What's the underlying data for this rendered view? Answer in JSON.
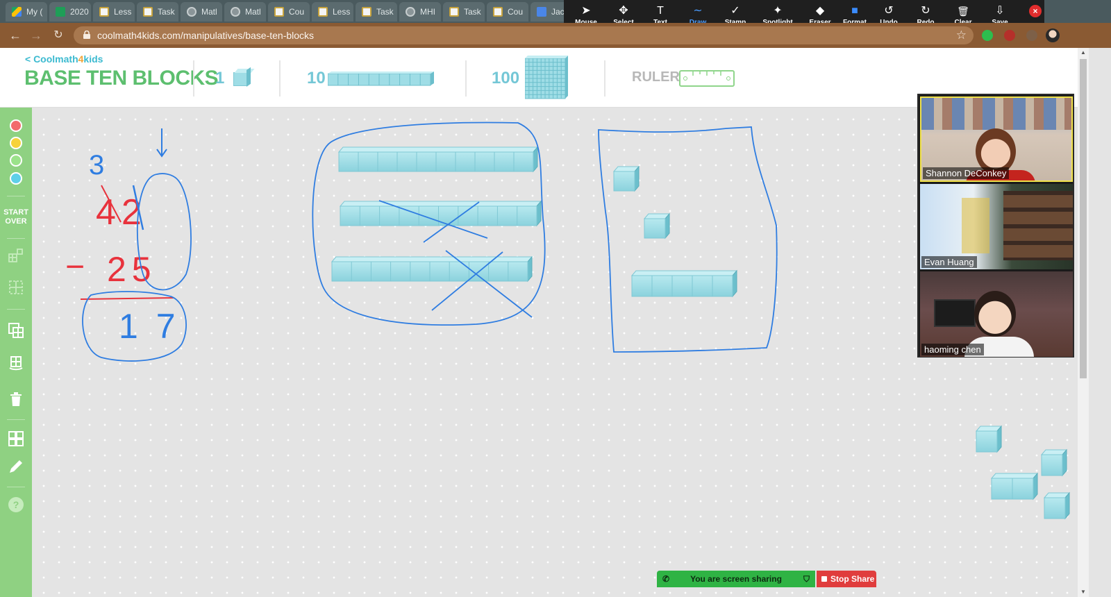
{
  "browser": {
    "tabs": [
      {
        "label": "My (",
        "icon": "drive"
      },
      {
        "label": "2020",
        "icon": "sheets"
      },
      {
        "label": "Less",
        "icon": "doc"
      },
      {
        "label": "Task",
        "icon": "doc"
      },
      {
        "label": "Matl",
        "icon": "globe"
      },
      {
        "label": "Matl",
        "icon": "globe"
      },
      {
        "label": "Cou",
        "icon": "doc"
      },
      {
        "label": "Less",
        "icon": "doc"
      },
      {
        "label": "Task",
        "icon": "doc"
      },
      {
        "label": "MHI",
        "icon": "globe"
      },
      {
        "label": "Task",
        "icon": "doc"
      },
      {
        "label": "Cou",
        "icon": "doc"
      },
      {
        "label": "Jacc",
        "icon": "gdoc"
      }
    ],
    "url": "coolmath4kids.com/manipulatives/base-ten-blocks"
  },
  "annotation_toolbar": {
    "tools": [
      {
        "label": "Mouse",
        "icon": "cursor-icon"
      },
      {
        "label": "Select",
        "icon": "move-icon"
      },
      {
        "label": "Text",
        "icon": "text-icon"
      },
      {
        "label": "Draw",
        "icon": "squiggle-icon",
        "active": true
      },
      {
        "label": "Stamp",
        "icon": "check-icon"
      },
      {
        "label": "Spotlight",
        "icon": "wand-icon"
      },
      {
        "label": "Eraser",
        "icon": "eraser-icon"
      },
      {
        "label": "Format",
        "icon": "format-icon"
      },
      {
        "label": "Undo",
        "icon": "undo-icon"
      },
      {
        "label": "Redo",
        "icon": "redo-icon"
      },
      {
        "label": "Clear",
        "icon": "trash-icon"
      },
      {
        "label": "Save",
        "icon": "save-icon"
      }
    ],
    "active_color": "#4a9cff"
  },
  "app": {
    "back_link_prefix": "< Coolmath",
    "back_link_four": "4",
    "back_link_suffix": "kids",
    "title": "BASE TEN BLOCKS",
    "block_ones_label": "1",
    "block_tens_label": "10",
    "block_hundreds_label": "100",
    "ruler_label": "RULER",
    "start_over_label": "START OVER",
    "colors": {
      "brand_green": "#5dbf6f",
      "block_blue": "#9fdde6"
    },
    "palette": [
      "#f26b6b",
      "#f7d23a",
      "#9be28a",
      "#5fd0e8"
    ]
  },
  "whiteboard": {
    "problem": {
      "borrow_digit": "3",
      "minuend": "42",
      "operator": "−",
      "subtrahend": "25",
      "result": "17"
    },
    "pen_colors": {
      "blue": "#2f7de1",
      "red": "#e8323c"
    }
  },
  "video_gallery": {
    "participants": [
      {
        "name": "Shannon DeConkey",
        "active_speaker": true
      },
      {
        "name": "Evan Huang"
      },
      {
        "name": "haoming chen"
      }
    ]
  },
  "share_bar": {
    "status": "You are screen sharing",
    "stop_label": "Stop Share"
  }
}
